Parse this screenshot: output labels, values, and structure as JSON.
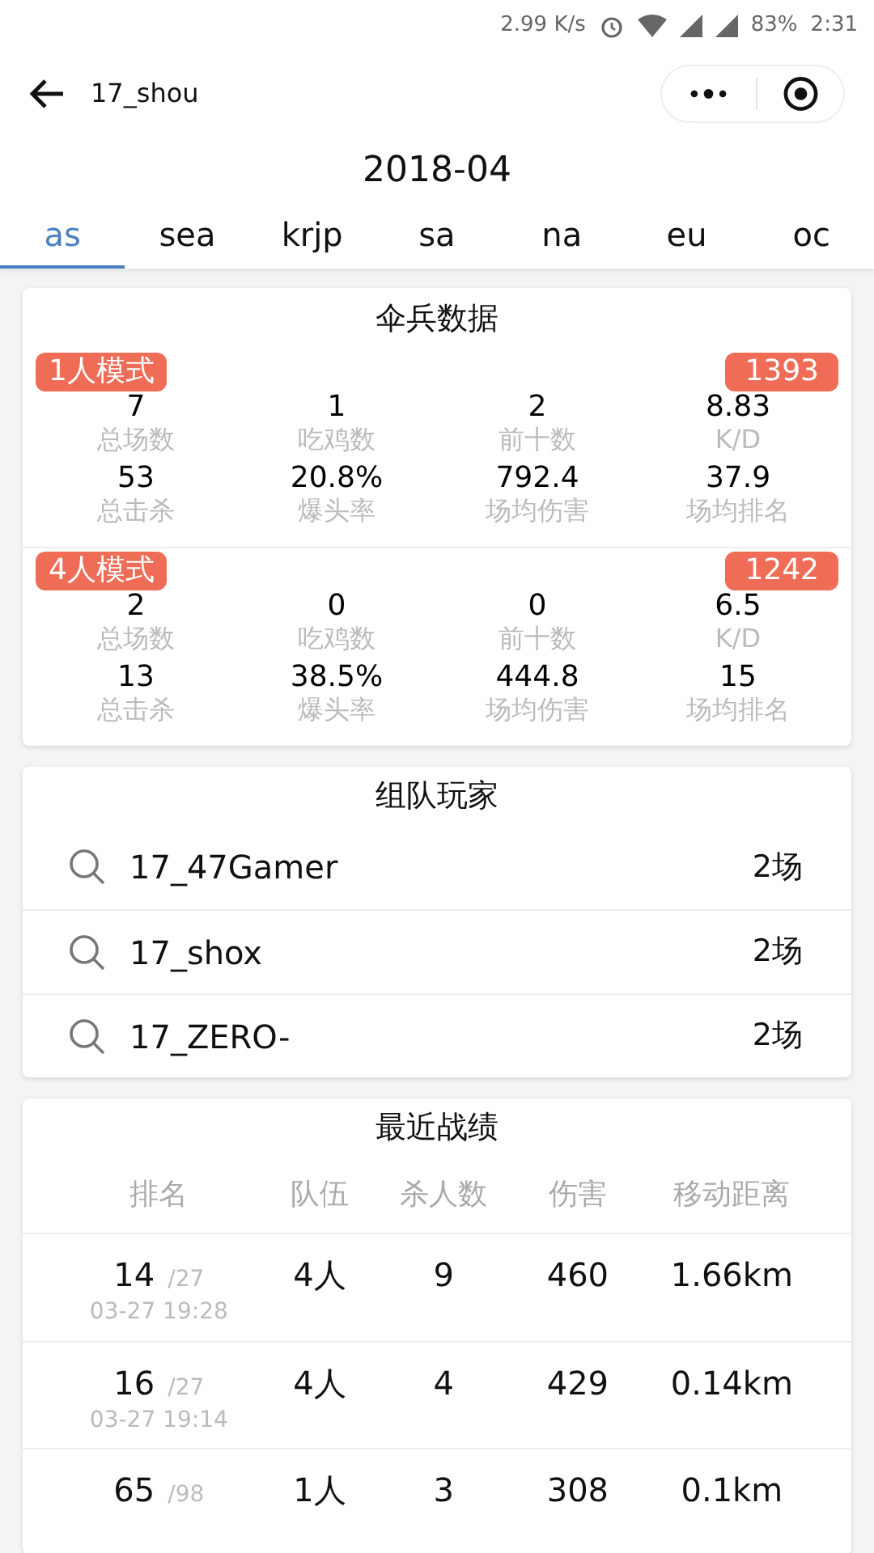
{
  "status_bar": {
    "speed": "2.99 K/s",
    "battery": "83%",
    "time": "2:31"
  },
  "header": {
    "title": "17_shou"
  },
  "month": "2018-04",
  "tabs": [
    {
      "label": "as",
      "selected": true
    },
    {
      "label": "sea",
      "selected": false
    },
    {
      "label": "krjp",
      "selected": false
    },
    {
      "label": "sa",
      "selected": false
    },
    {
      "label": "na",
      "selected": false
    },
    {
      "label": "eu",
      "selected": false
    },
    {
      "label": "oc",
      "selected": false
    }
  ],
  "stats": {
    "title": "伞兵数据",
    "modes": [
      {
        "mode": "1人模式",
        "rating": "1393",
        "stats": [
          {
            "value": "7",
            "label": "总场数"
          },
          {
            "value": "1",
            "label": "吃鸡数"
          },
          {
            "value": "2",
            "label": "前十数"
          },
          {
            "value": "8.83",
            "label": "K/D"
          },
          {
            "value": "53",
            "label": "总击杀"
          },
          {
            "value": "20.8%",
            "label": "爆头率"
          },
          {
            "value": "792.4",
            "label": "场均伤害"
          },
          {
            "value": "37.9",
            "label": "场均排名"
          }
        ]
      },
      {
        "mode": "4人模式",
        "rating": "1242",
        "stats": [
          {
            "value": "2",
            "label": "总场数"
          },
          {
            "value": "0",
            "label": "吃鸡数"
          },
          {
            "value": "0",
            "label": "前十数"
          },
          {
            "value": "6.5",
            "label": "K/D"
          },
          {
            "value": "13",
            "label": "总击杀"
          },
          {
            "value": "38.5%",
            "label": "爆头率"
          },
          {
            "value": "444.8",
            "label": "场均伤害"
          },
          {
            "value": "15",
            "label": "场均排名"
          }
        ]
      }
    ]
  },
  "teammates": {
    "title": "组队玩家",
    "players": [
      {
        "name": "17_47Gamer",
        "games": "2场"
      },
      {
        "name": "17_shox",
        "games": "2场"
      },
      {
        "name": "17_ZERO-",
        "games": "2场"
      }
    ]
  },
  "recent": {
    "title": "最近战绩",
    "columns": [
      "排名",
      "队伍",
      "杀人数",
      "伤害",
      "移动距离"
    ],
    "rows": [
      {
        "rank": "14",
        "total": "/27",
        "time": "03-27 19:28",
        "team": "4人",
        "kills": "9",
        "damage": "460",
        "distance": "1.66km"
      },
      {
        "rank": "16",
        "total": "/27",
        "time": "03-27 19:14",
        "team": "4人",
        "kills": "4",
        "damage": "429",
        "distance": "0.14km"
      },
      {
        "rank": "65",
        "total": "/98",
        "team": "1人",
        "kills": "3",
        "damage": "308",
        "distance": "0.1km"
      }
    ]
  }
}
